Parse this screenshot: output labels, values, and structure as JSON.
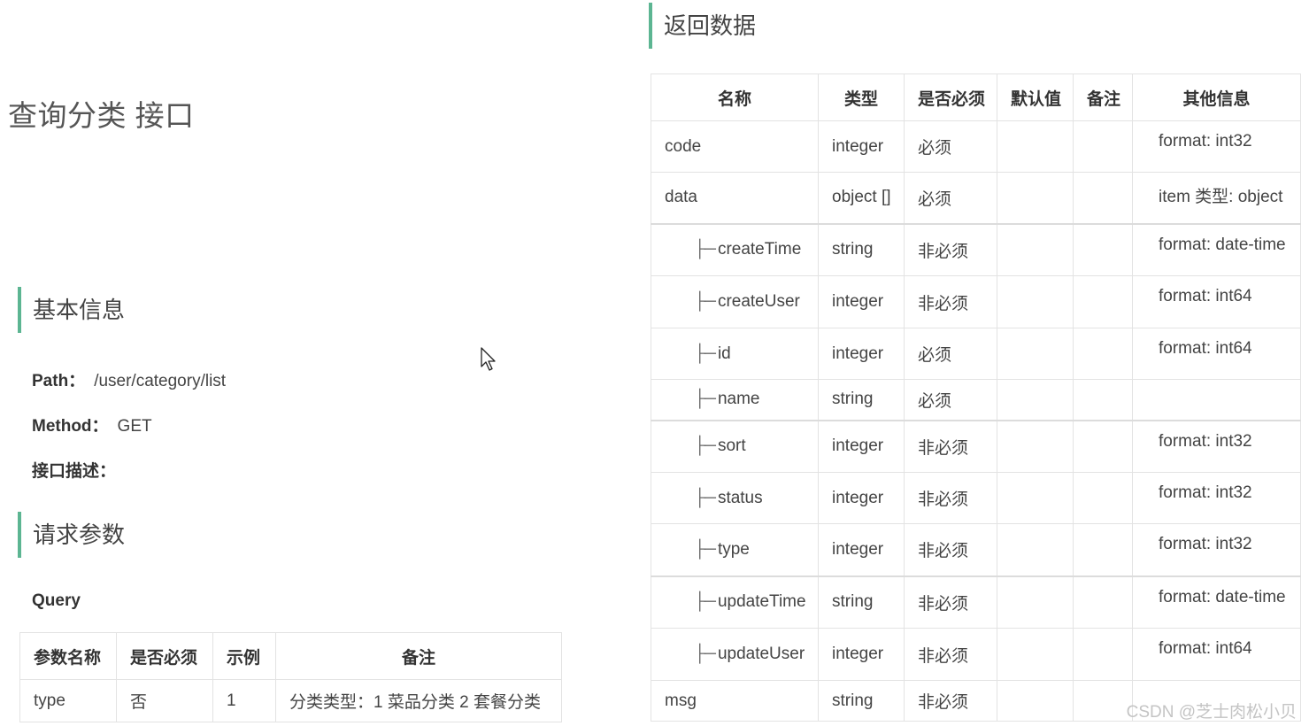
{
  "page": {
    "title": "查询分类 接口"
  },
  "basic_info": {
    "heading": "基本信息",
    "path_label": "Path：",
    "path_value": "/user/category/list",
    "method_label": "Method：",
    "method_value": "GET",
    "desc_label": "接口描述："
  },
  "request": {
    "heading": "请求参数",
    "query_label": "Query",
    "headers": [
      "参数名称",
      "是否必须",
      "示例",
      "备注"
    ],
    "rows": [
      {
        "name": "type",
        "required": "否",
        "example": "1",
        "note": "分类类型：1 菜品分类 2 套餐分类"
      }
    ]
  },
  "response": {
    "heading": "返回数据",
    "headers": [
      "名称",
      "类型",
      "是否必须",
      "默认值",
      "备注",
      "其他信息"
    ],
    "tree_prefix": "├─",
    "rows": [
      {
        "name": "code",
        "type": "integer",
        "required": "必须",
        "default": "",
        "note": "",
        "other": "format: int32"
      },
      {
        "name": "data",
        "type": "object []",
        "required": "必须",
        "default": "",
        "note": "",
        "other": "item 类型: object"
      },
      {
        "name": "createTime",
        "type": "string",
        "required": "非必须",
        "default": "",
        "note": "",
        "other": "format: date-time"
      },
      {
        "name": "createUser",
        "type": "integer",
        "required": "非必须",
        "default": "",
        "note": "",
        "other": "format: int64"
      },
      {
        "name": "id",
        "type": "integer",
        "required": "必须",
        "default": "",
        "note": "",
        "other": "format: int64"
      },
      {
        "name": "name",
        "type": "string",
        "required": "必须",
        "default": "",
        "note": "",
        "other": ""
      },
      {
        "name": "sort",
        "type": "integer",
        "required": "非必须",
        "default": "",
        "note": "",
        "other": "format: int32"
      },
      {
        "name": "status",
        "type": "integer",
        "required": "非必须",
        "default": "",
        "note": "",
        "other": "format: int32"
      },
      {
        "name": "type",
        "type": "integer",
        "required": "非必须",
        "default": "",
        "note": "",
        "other": "format: int32"
      },
      {
        "name": "updateTime",
        "type": "string",
        "required": "非必须",
        "default": "",
        "note": "",
        "other": "format: date-time"
      },
      {
        "name": "updateUser",
        "type": "integer",
        "required": "非必须",
        "default": "",
        "note": "",
        "other": "format: int64"
      },
      {
        "name": "msg",
        "type": "string",
        "required": "非必须",
        "default": "",
        "note": "",
        "other": ""
      }
    ]
  },
  "watermark": "CSDN @芝士肉松小贝",
  "colors": {
    "accent": "#5cb592",
    "border": "#e3e3e3"
  },
  "icons": {
    "cursor": "mouse-pointer-icon"
  }
}
